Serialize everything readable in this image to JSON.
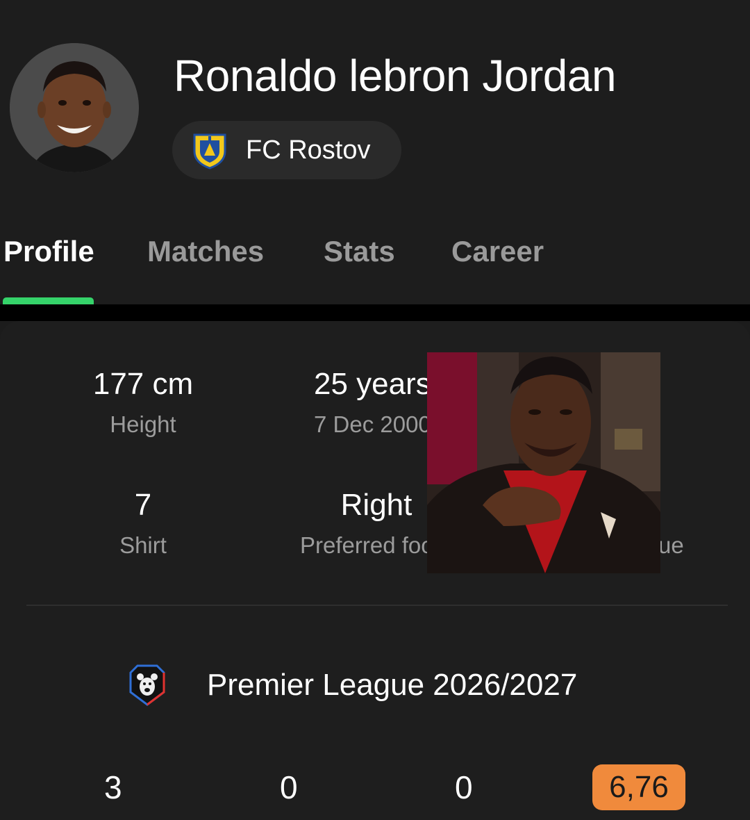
{
  "player": {
    "name": "Ronaldo lebron Jordan",
    "team": "FC Rostov"
  },
  "tabs": [
    {
      "label": "Profile",
      "active": true
    },
    {
      "label": "Matches",
      "active": false
    },
    {
      "label": "Stats",
      "active": false
    },
    {
      "label": "Career",
      "active": false
    }
  ],
  "colors": {
    "tab_indicator": "#35d36a",
    "rating_badge": "#f08a3c",
    "background": "#1c1c1c"
  },
  "profile": {
    "height_value": "177 cm",
    "height_label": "Height",
    "age_value": "25 years",
    "age_label": "7 Dec 2000",
    "shirt_value": "7",
    "shirt_label": "Shirt",
    "foot_value": "Right",
    "foot_label": "Preferred foot",
    "market_label_partial": "ue"
  },
  "league": {
    "name": "Premier League 2026/2027",
    "icon": "bear-league-icon"
  },
  "season_stats": {
    "values": [
      "3",
      "0",
      "0"
    ],
    "rating": "6,76"
  }
}
